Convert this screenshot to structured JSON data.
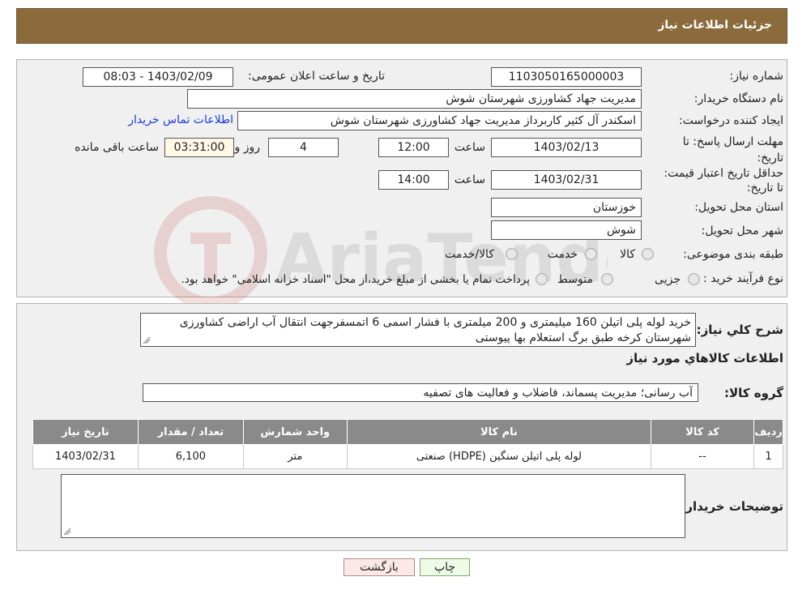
{
  "header": {
    "title": "جزئیات اطلاعات نیاز"
  },
  "info": {
    "need_number_label": "شماره نیاز:",
    "need_number": "1103050165000003",
    "announce_label": "تاریخ و ساعت اعلان عمومی:",
    "announce_value": "1403/02/09 - 08:03",
    "buyer_org_label": "نام دستگاه خریدار:",
    "buyer_org": "مدیریت جهاد کشاورزی شهرستان شوش",
    "requester_label": "ایجاد کننده درخواست:",
    "requester": "اسکندر آل کثیر کاربرداز مدیریت جهاد کشاورزی شهرستان شوش",
    "contact_link": "اطلاعات تماس خریدار",
    "deadline_label": "مهلت ارسال پاسخ: تا تاریخ:",
    "deadline_date": "1403/02/13",
    "time_label": "ساعت",
    "deadline_time": "12:00",
    "days": "4",
    "days_label": "روز و",
    "remaining": "03:31:00",
    "remaining_label": "ساعت باقی مانده",
    "price_validity_label": "حداقل تاریخ اعتبار قیمت: تا تاریخ:",
    "price_validity_date": "1403/02/31",
    "price_validity_time": "14:00",
    "province_label": "استان محل تحویل:",
    "province": "خوزستان",
    "city_label": "شهر محل تحویل:",
    "city": "شوش",
    "category_label": "طبقه بندی موضوعی:",
    "category_options": [
      "کالا",
      "خدمت",
      "کالا/خدمت"
    ],
    "process_label": "نوع فرآیند خرید :",
    "process_options": [
      "جزیی",
      "متوسط"
    ],
    "process_note": "پرداخت تمام یا بخشی از مبلغ خرید،از محل \"اسناد خزانه اسلامی\" خواهد بود."
  },
  "details": {
    "summary_label": "شرح کلي نياز:",
    "summary": "خرید لوله پلی اتیلن 160 میلیمتری و 200 میلمتری با فشار اسمی 6 اتمسفرجهت انتقال آب اراضی کشاورزی شهرستان کرخه طبق برگ استعلام بها پیوستی",
    "goods_info_title": "اطلاعات کالاهاي مورد نياز",
    "goods_group_label": "گروه کالا:",
    "goods_group": "آب رسانی؛ مدیریت پسماند، فاضلاب و فعالیت های تصفیه",
    "table": {
      "headers": [
        "ردیف",
        "کد کالا",
        "نام کالا",
        "واحد شمارش",
        "تعداد / مقدار",
        "تاریخ نیاز"
      ],
      "rows": [
        [
          "1",
          "--",
          "لوله پلی اتیلن سنگین (HDPE) صنعتی",
          "متر",
          "6,100",
          "1403/02/31"
        ]
      ]
    },
    "buyer_notes_label": "توضیحات خریدار:",
    "buyer_notes": ""
  },
  "buttons": {
    "print": "چاپ",
    "back": "بازگشت"
  },
  "watermark": {
    "text": "AriaTender.neT"
  }
}
